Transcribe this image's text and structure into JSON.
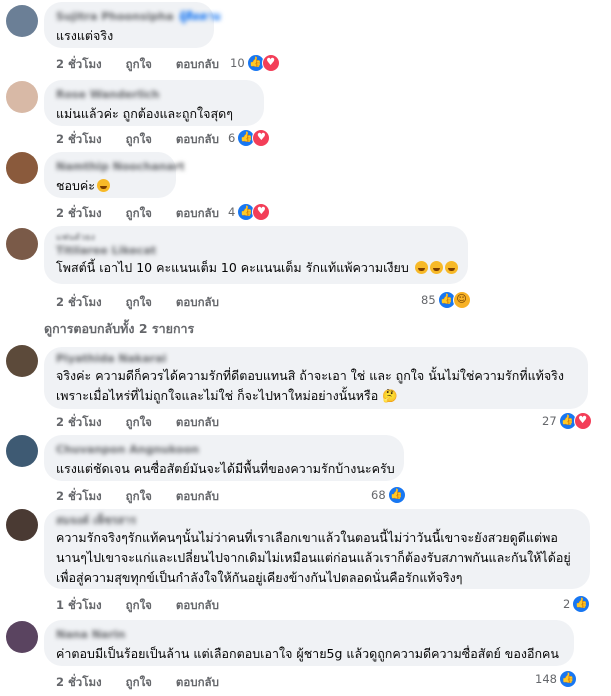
{
  "comments": [
    {
      "name": "Sujitra Phoonsipha",
      "name_tag": "ผู้ติดตาม",
      "text": "แรงแต่จริง",
      "time": "2 ชั่วโมง",
      "like": "ถูกใจ",
      "reply": "ตอบกลับ",
      "count": "10",
      "reactions": [
        "like",
        "love"
      ],
      "avatar_color": "#6b7f96"
    },
    {
      "name": "Rose Wanderlich",
      "text": "แม่นแล้วค่ะ ถูกต้องและถูกใจสุดๆ",
      "time": "2 ชั่วโมง",
      "like": "ถูกใจ",
      "reply": "ตอบกลับ",
      "count": "6",
      "reactions": [
        "like",
        "love"
      ],
      "avatar_color": "#d8b9a6"
    },
    {
      "name": "Namthip Noochanart",
      "text": "ชอบค่ะ",
      "time": "2 ชั่วโมง",
      "like": "ถูกใจ",
      "reply": "ตอบกลับ",
      "count": "4",
      "reactions": [
        "like",
        "love"
      ],
      "avatar_color": "#8a5a3c"
    },
    {
      "name": "Titilaree Likecat",
      "badge": "แฟนตัวยง",
      "text": "โพสต์นี้ เอาไป 10 คะแนนเต็ม 10 คะแนนเต็ม รักแท้แพ้ความเงียบ",
      "time": "2 ชั่วโมง",
      "like": "ถูกใจ",
      "reply": "ตอบกลับ",
      "count": "85",
      "reactions": [
        "like",
        "haha"
      ],
      "avatar_color": "#7a5a48"
    },
    {
      "name": "Piyathida Nakarai",
      "text_lines": [
        "จริงค่ะ ความดีก็ควรได้ความรักที่ดีตอบแทนสิ ถ้าจะเอา ใช่ และ ถูกใจ นั้นไม่ใช่ความรักที่แท้จริง",
        "เพราะเมื่อไหร่ที่ไม่ถูกใจและไม่ใช่ ก็จะไปหาใหม่อย่างนั้นหรือ 🤔"
      ],
      "time": "2 ชั่วโมง",
      "like": "ถูกใจ",
      "reply": "ตอบกลับ",
      "count": "27",
      "reactions": [
        "like",
        "love"
      ],
      "avatar_color": "#5c4a3a"
    },
    {
      "name": "Chuvanpon Angnukoon",
      "text": "แรงแต่ชัดเจน คนซื่อสัตย์มันจะได้มีพื้นที่ของความรักบ้างนะครับ",
      "time": "2 ชั่วโมง",
      "like": "ถูกใจ",
      "reply": "ตอบกลับ",
      "count": "68",
      "reactions": [
        "like"
      ],
      "avatar_color": "#3e5a73"
    },
    {
      "name": "สมจงค์ เพ็ชรสาร",
      "text_lines": [
        "ความรักจริงๆรักแท้คนๆนั้นไม่ว่าคนที่เราเลือกเขาแล้วในตอนนี้ไม่ว่าวันนี้เขาจะยังสวยดูดีแต่พอ",
        "นานๆไปเขาจะแก่และเปลี่ยนไปจากเดิมไม่เหมือนแต่ก่อนแล้วเราก็ต้องรับสภาพกันและกันให้ได้อยู่",
        "เพื่อสู่ความสุขทุกข์เป็นกำลังใจให้กันอยู่เคียงข้างกันไปตลอดนั่นคือรักแท้จริงๆ"
      ],
      "time": "1 ชั่วโมง",
      "like": "ถูกใจ",
      "reply": "ตอบกลับ",
      "count": "2",
      "reactions": [
        "like"
      ],
      "avatar_color": "#4a3a33"
    },
    {
      "name": "Nana Narin",
      "text": "ค่าตอบมีเป็นร้อยเป็นล้าน แต่เลือกตอบเอาใจ ผู้ชาย5g แล้วดูถูกความดีความซื่อสัตย์ ของอีกคน",
      "time": "2 ชั่วโมง",
      "like": "ถูกใจ",
      "reply": "ตอบกลับ",
      "count": "148",
      "reactions": [
        "like"
      ],
      "avatar_color": "#5a4460"
    }
  ],
  "view_replies": "ดูการตอบกลับทั้ง 2 รายการ"
}
